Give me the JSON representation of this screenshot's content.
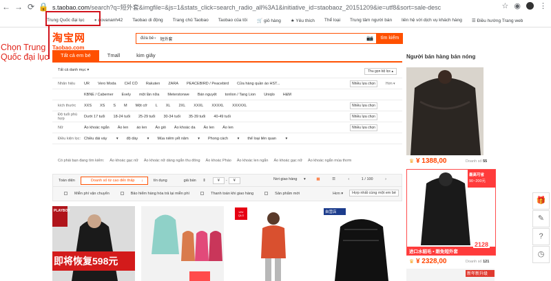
{
  "browser": {
    "url_host": "s.taobao.com",
    "url_rest": "/search?q=短外套&imgfile=&js=1&stats_click=search_radio_all%3A1&initiative_id=staobaoz_20151209&ie=utf8&sort=sale-desc",
    "bookmarks": [
      "Trung Quốc đại lục",
      "dovananh42",
      "Taobao di động",
      "Trang chủ Taobao",
      "Taobao của tôi",
      "giỏ hàng",
      "Yêu thích",
      "Thể loại",
      "Trung tâm người bán",
      "liên hệ với dịch vụ khách hàng",
      "Điều hướng Trang web"
    ]
  },
  "annotation": {
    "text": "Chọn Trung Quốc đại lục"
  },
  "header": {
    "logo_cn": "淘宝网",
    "logo_en": "Taobao.com",
    "search_label": "đứa bé",
    "search_value": "短外套",
    "search_button": "tìm kiếm"
  },
  "tabs": [
    "Tất cả em bé",
    "Tmall",
    "kim giây"
  ],
  "category_head": {
    "left": "Tất cả danh mục",
    "right": "Thu gọn bộ lọc"
  },
  "filters": [
    {
      "name": "Nhãn hiệu",
      "values": [
        "UR",
        "Vero Moda",
        "CHỈ CÓ",
        "Rakuten",
        "ZARA",
        "PEACEBIRD / Peacebird",
        "Cửa hàng quần áo HST..."
      ],
      "button": "Nhiều lựa chọn",
      "more": "Hơn"
    },
    {
      "name": "",
      "values": [
        "KBNE / Caberner",
        "Evely",
        "một lần nữa",
        "Meterstonwe",
        "Bán nguyệt",
        "tonlion / Tang Lion",
        "Uniqlo",
        "H&M"
      ],
      "button": "",
      "more": ""
    },
    {
      "name": "kích thước",
      "values": [
        "XXS",
        "XS",
        "S",
        "M",
        "Một cỡ",
        "L",
        "XL",
        "2XL",
        "XXXL",
        "XXXXL",
        "XXXXXL"
      ],
      "button": "Nhiều lựa chọn",
      "more": ""
    },
    {
      "name": "Độ tuổi phù hợp",
      "values": [
        "Dưới 17 tuổi",
        "18-24 tuổi",
        "25-29 tuổi",
        "30-34 tuổi",
        "35-39 tuổi",
        "40-49 tuổi"
      ],
      "button": "Nhiều lựa chọn",
      "more": ""
    },
    {
      "name": "Nữ",
      "values": [
        "Áo khoác ngắn",
        "Áo len",
        "áo len",
        "Áo gió",
        "Áo khoác da",
        "Áo len",
        "Áo len"
      ],
      "button": "Nhiều lựa chọn",
      "more": ""
    },
    {
      "name": "Điều kiện lọc:",
      "values": [
        "Chiều dài váy",
        "độ dày",
        "Mùa niêm yết năm",
        "Phong cách",
        "thể loại liên quan"
      ],
      "button": "",
      "more": ""
    }
  ],
  "lifestyle": {
    "label": "Có phải bạn đang tìm kiếm:",
    "items": [
      "Áo khoác gạc nữ",
      "Áo khoác nữ dáng ngắn thu đông",
      "Áo khoác Pháo",
      "Áo khoác len ngắn",
      "Áo khoác gạc nữ",
      "Áo khoác ngắn mùa thơm"
    ]
  },
  "sortbar": {
    "row1": [
      "Toàn diện",
      "Doanh số từ cao đến thấp",
      "tín dụng",
      "giá bán"
    ],
    "price_from": "¥",
    "price_to": "¥",
    "location": "Nơi giao hàng",
    "pager": "1 / 100",
    "row2": [
      "Miễn phí vận chuyển",
      "Bảo hiểm hàng hóa trả lại miễn phí",
      "Thanh toán khi giao hàng",
      "Sản phẩm mới"
    ],
    "more": "Hơn",
    "compare": "Hợp nhất cùng một em bé"
  },
  "products": [
    {
      "badge": "PLAYBOY",
      "text": "即将恢复598元",
      "text2": ""
    },
    {
      "badge": "",
      "text": "",
      "text2": ""
    },
    {
      "badge": "UNI QLO",
      "text": "",
      "text2": ""
    },
    {
      "badge": "自营店",
      "text": "",
      "text2": ""
    }
  ],
  "sidebar": {
    "title": "Người bán hàng bán nóng",
    "items": [
      {
        "price": "¥ 1388,00",
        "sales_label": "Doanh số",
        "sales": "55"
      },
      {
        "price": "¥ 2328,00",
        "sales_label": "Doanh số",
        "sales": "121",
        "promo_top": "最高可省",
        "promo_sub": "90~200元",
        "promo_strip": "进口水貂毛 • 跟免短外套",
        "promo_price": "2128"
      }
    ],
    "bottom_strip": "新年新升级"
  },
  "widgets": [
    "gift-icon",
    "edit-icon",
    "help-icon",
    "clock-icon"
  ]
}
